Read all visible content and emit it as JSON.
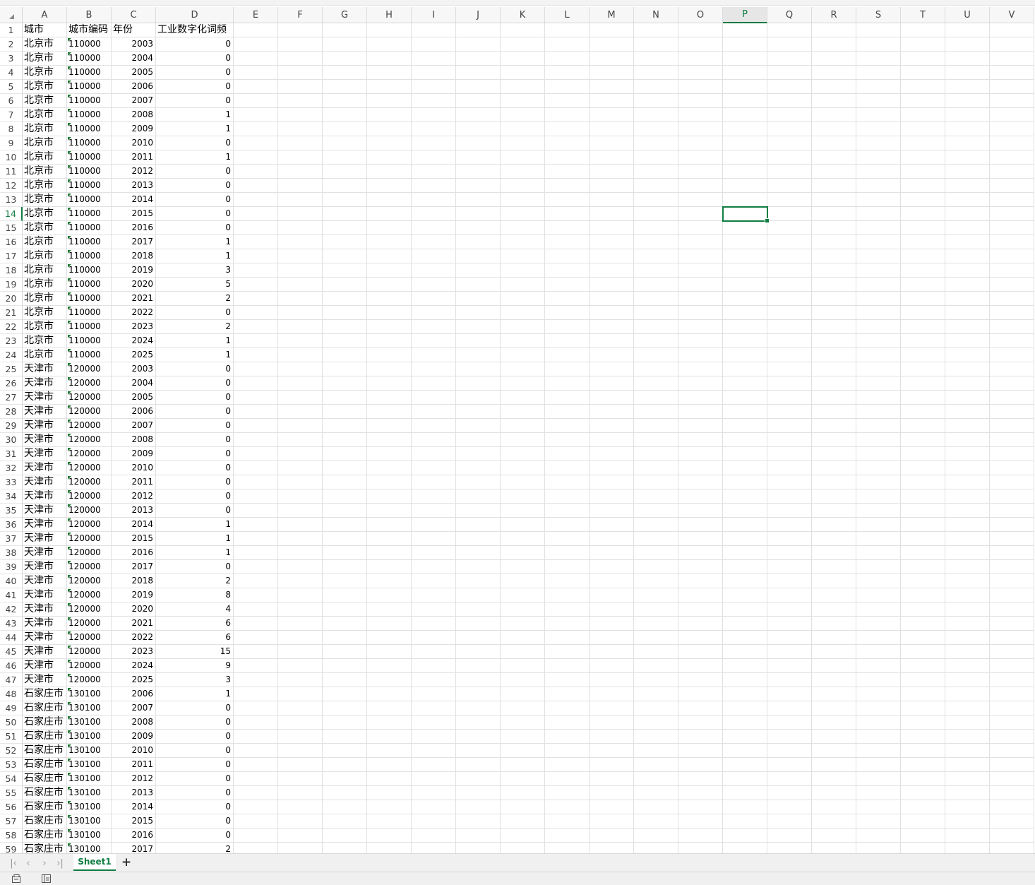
{
  "columns": [
    "A",
    "B",
    "C",
    "D",
    "E",
    "F",
    "G",
    "H",
    "I",
    "J",
    "K",
    "L",
    "M",
    "N",
    "O",
    "P",
    "Q",
    "R",
    "S",
    "T",
    "U",
    "V"
  ],
  "active_cell": {
    "column": "P",
    "row": 14
  },
  "headers": [
    "城市",
    "城市编码",
    "年份",
    "工业数字化词频"
  ],
  "rows": [
    [
      "北京市",
      "110000",
      "2003",
      "0"
    ],
    [
      "北京市",
      "110000",
      "2004",
      "0"
    ],
    [
      "北京市",
      "110000",
      "2005",
      "0"
    ],
    [
      "北京市",
      "110000",
      "2006",
      "0"
    ],
    [
      "北京市",
      "110000",
      "2007",
      "0"
    ],
    [
      "北京市",
      "110000",
      "2008",
      "1"
    ],
    [
      "北京市",
      "110000",
      "2009",
      "1"
    ],
    [
      "北京市",
      "110000",
      "2010",
      "0"
    ],
    [
      "北京市",
      "110000",
      "2011",
      "1"
    ],
    [
      "北京市",
      "110000",
      "2012",
      "0"
    ],
    [
      "北京市",
      "110000",
      "2013",
      "0"
    ],
    [
      "北京市",
      "110000",
      "2014",
      "0"
    ],
    [
      "北京市",
      "110000",
      "2015",
      "0"
    ],
    [
      "北京市",
      "110000",
      "2016",
      "0"
    ],
    [
      "北京市",
      "110000",
      "2017",
      "1"
    ],
    [
      "北京市",
      "110000",
      "2018",
      "1"
    ],
    [
      "北京市",
      "110000",
      "2019",
      "3"
    ],
    [
      "北京市",
      "110000",
      "2020",
      "5"
    ],
    [
      "北京市",
      "110000",
      "2021",
      "2"
    ],
    [
      "北京市",
      "110000",
      "2022",
      "0"
    ],
    [
      "北京市",
      "110000",
      "2023",
      "2"
    ],
    [
      "北京市",
      "110000",
      "2024",
      "1"
    ],
    [
      "北京市",
      "110000",
      "2025",
      "1"
    ],
    [
      "天津市",
      "120000",
      "2003",
      "0"
    ],
    [
      "天津市",
      "120000",
      "2004",
      "0"
    ],
    [
      "天津市",
      "120000",
      "2005",
      "0"
    ],
    [
      "天津市",
      "120000",
      "2006",
      "0"
    ],
    [
      "天津市",
      "120000",
      "2007",
      "0"
    ],
    [
      "天津市",
      "120000",
      "2008",
      "0"
    ],
    [
      "天津市",
      "120000",
      "2009",
      "0"
    ],
    [
      "天津市",
      "120000",
      "2010",
      "0"
    ],
    [
      "天津市",
      "120000",
      "2011",
      "0"
    ],
    [
      "天津市",
      "120000",
      "2012",
      "0"
    ],
    [
      "天津市",
      "120000",
      "2013",
      "0"
    ],
    [
      "天津市",
      "120000",
      "2014",
      "1"
    ],
    [
      "天津市",
      "120000",
      "2015",
      "1"
    ],
    [
      "天津市",
      "120000",
      "2016",
      "1"
    ],
    [
      "天津市",
      "120000",
      "2017",
      "0"
    ],
    [
      "天津市",
      "120000",
      "2018",
      "2"
    ],
    [
      "天津市",
      "120000",
      "2019",
      "8"
    ],
    [
      "天津市",
      "120000",
      "2020",
      "4"
    ],
    [
      "天津市",
      "120000",
      "2021",
      "6"
    ],
    [
      "天津市",
      "120000",
      "2022",
      "6"
    ],
    [
      "天津市",
      "120000",
      "2023",
      "15"
    ],
    [
      "天津市",
      "120000",
      "2024",
      "9"
    ],
    [
      "天津市",
      "120000",
      "2025",
      "3"
    ],
    [
      "石家庄市",
      "130100",
      "2006",
      "1"
    ],
    [
      "石家庄市",
      "130100",
      "2007",
      "0"
    ],
    [
      "石家庄市",
      "130100",
      "2008",
      "0"
    ],
    [
      "石家庄市",
      "130100",
      "2009",
      "0"
    ],
    [
      "石家庄市",
      "130100",
      "2010",
      "0"
    ],
    [
      "石家庄市",
      "130100",
      "2011",
      "0"
    ],
    [
      "石家庄市",
      "130100",
      "2012",
      "0"
    ],
    [
      "石家庄市",
      "130100",
      "2013",
      "0"
    ],
    [
      "石家庄市",
      "130100",
      "2014",
      "0"
    ],
    [
      "石家庄市",
      "130100",
      "2015",
      "0"
    ],
    [
      "石家庄市",
      "130100",
      "2016",
      "0"
    ],
    [
      "石家庄市",
      "130100",
      "2017",
      "2"
    ]
  ],
  "sheet_tabs": [
    "Sheet1"
  ],
  "add_sheet_label": "+",
  "nav": {
    "first": "|‹",
    "prev": "‹",
    "next": "›",
    "last": "›|"
  },
  "icons": {
    "status_left": "macro-record-icon",
    "status_right": "accessibility-icon"
  },
  "colors": {
    "accent": "#107c41",
    "gridline": "#e1e1e1",
    "header_bg": "#f7f7f7"
  }
}
